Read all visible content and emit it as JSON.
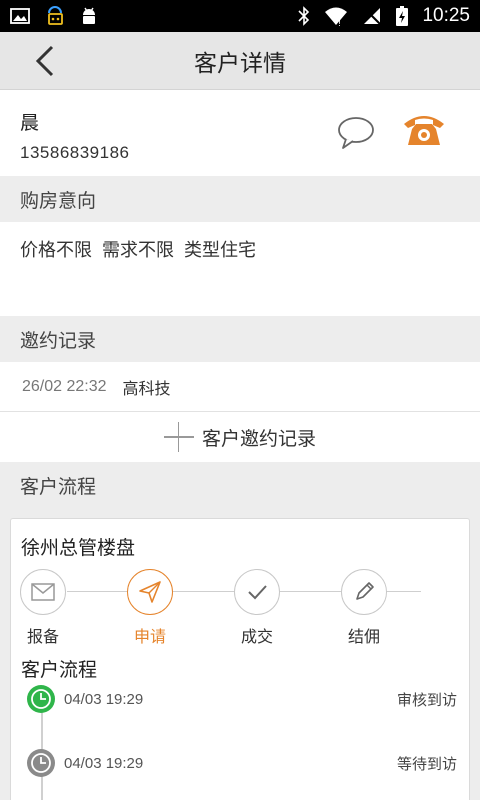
{
  "status_bar": {
    "time": "10:25",
    "left_icons": [
      "image-icon",
      "notification-icon",
      "android-icon"
    ],
    "right_icons": [
      "bluetooth-icon",
      "wifi-icon",
      "no-sim-icon",
      "battery-icon"
    ]
  },
  "nav": {
    "title": "客户详情"
  },
  "customer": {
    "name": "晨",
    "phone": "13586839186"
  },
  "sections": {
    "intent": "购房意向",
    "invite": "邀约记录",
    "process": "客户流程"
  },
  "intent_tags": [
    "价格不限",
    "需求不限",
    "类型住宅"
  ],
  "invites": [
    {
      "date": "26/02 22:32",
      "place": "高科技"
    }
  ],
  "invite_add_label": "客户邀约记录",
  "process": {
    "project": "徐州总管楼盘",
    "steps": [
      {
        "label": "报备",
        "icon": "envelope-icon",
        "active": false
      },
      {
        "label": "申请",
        "icon": "send-icon",
        "active": true
      },
      {
        "label": "成交",
        "icon": "check-icon",
        "active": false
      },
      {
        "label": "结佣",
        "icon": "pencil-icon",
        "active": false
      }
    ],
    "flow_title": "客户流程",
    "timeline": [
      {
        "time": "04/03 19:29",
        "status": "审核到访",
        "color": "#2fb54a"
      },
      {
        "time": "04/03 19:29",
        "status": "等待到访",
        "color": "#8a8a8a"
      }
    ]
  },
  "colors": {
    "accent": "#e5842c",
    "done": "#2fb54a",
    "pending": "#8a8a8a"
  }
}
